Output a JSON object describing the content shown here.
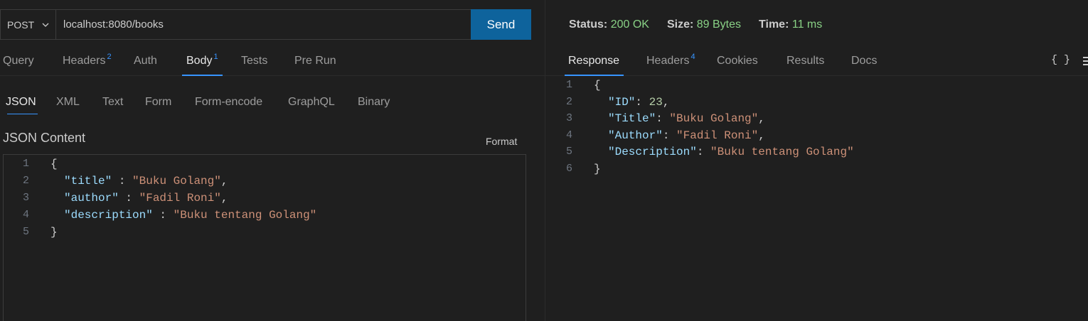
{
  "request": {
    "method": "POST",
    "url": "localhost:8080/books",
    "send_label": "Send"
  },
  "tabs": [
    {
      "label": "Query",
      "badge": ""
    },
    {
      "label": "Headers",
      "badge": "2"
    },
    {
      "label": "Auth",
      "badge": ""
    },
    {
      "label": "Body",
      "badge": "1"
    },
    {
      "label": "Tests",
      "badge": ""
    },
    {
      "label": "Pre Run",
      "badge": ""
    }
  ],
  "body_types": [
    "JSON",
    "XML",
    "Text",
    "Form",
    "Form-encode",
    "GraphQL",
    "Binary"
  ],
  "json_content_title": "JSON Content",
  "format_label": "Format",
  "request_body": {
    "line_numbers": [
      "1",
      "2",
      "3",
      "4",
      "5"
    ],
    "open": "{",
    "close": "}",
    "fields": [
      {
        "key": "\"title\"",
        "value": "\"Buku Golang\""
      },
      {
        "key": "\"author\"",
        "value": "\"Fadil Roni\""
      },
      {
        "key": "\"description\"",
        "value": "\"Buku tentang Golang\""
      }
    ]
  },
  "response_status": {
    "status_label": "Status:",
    "status_value": "200 OK",
    "size_label": "Size:",
    "size_value": "89 Bytes",
    "time_label": "Time:",
    "time_value": "11 ms"
  },
  "response_tabs": [
    {
      "label": "Response",
      "badge": ""
    },
    {
      "label": "Headers",
      "badge": "4"
    },
    {
      "label": "Cookies",
      "badge": ""
    },
    {
      "label": "Results",
      "badge": ""
    },
    {
      "label": "Docs",
      "badge": ""
    }
  ],
  "response_body": {
    "line_numbers": [
      "1",
      "2",
      "3",
      "4",
      "5",
      "6"
    ],
    "open": "{",
    "close": "}",
    "id_key": "\"ID\"",
    "id_value": "23",
    "fields": [
      {
        "key": "\"Title\"",
        "value": "\"Buku Golang\""
      },
      {
        "key": "\"Author\"",
        "value": "\"Fadil Roni\""
      },
      {
        "key": "\"Description\"",
        "value": "\"Buku tentang Golang\""
      }
    ]
  },
  "braces_label": "{ }",
  "colors": {
    "accent": "#3794ff",
    "send_button": "#0e639c",
    "status_ok": "#89d185",
    "json_key": "#9cdcfe",
    "json_string": "#ce9178",
    "json_number": "#b5cea8"
  }
}
